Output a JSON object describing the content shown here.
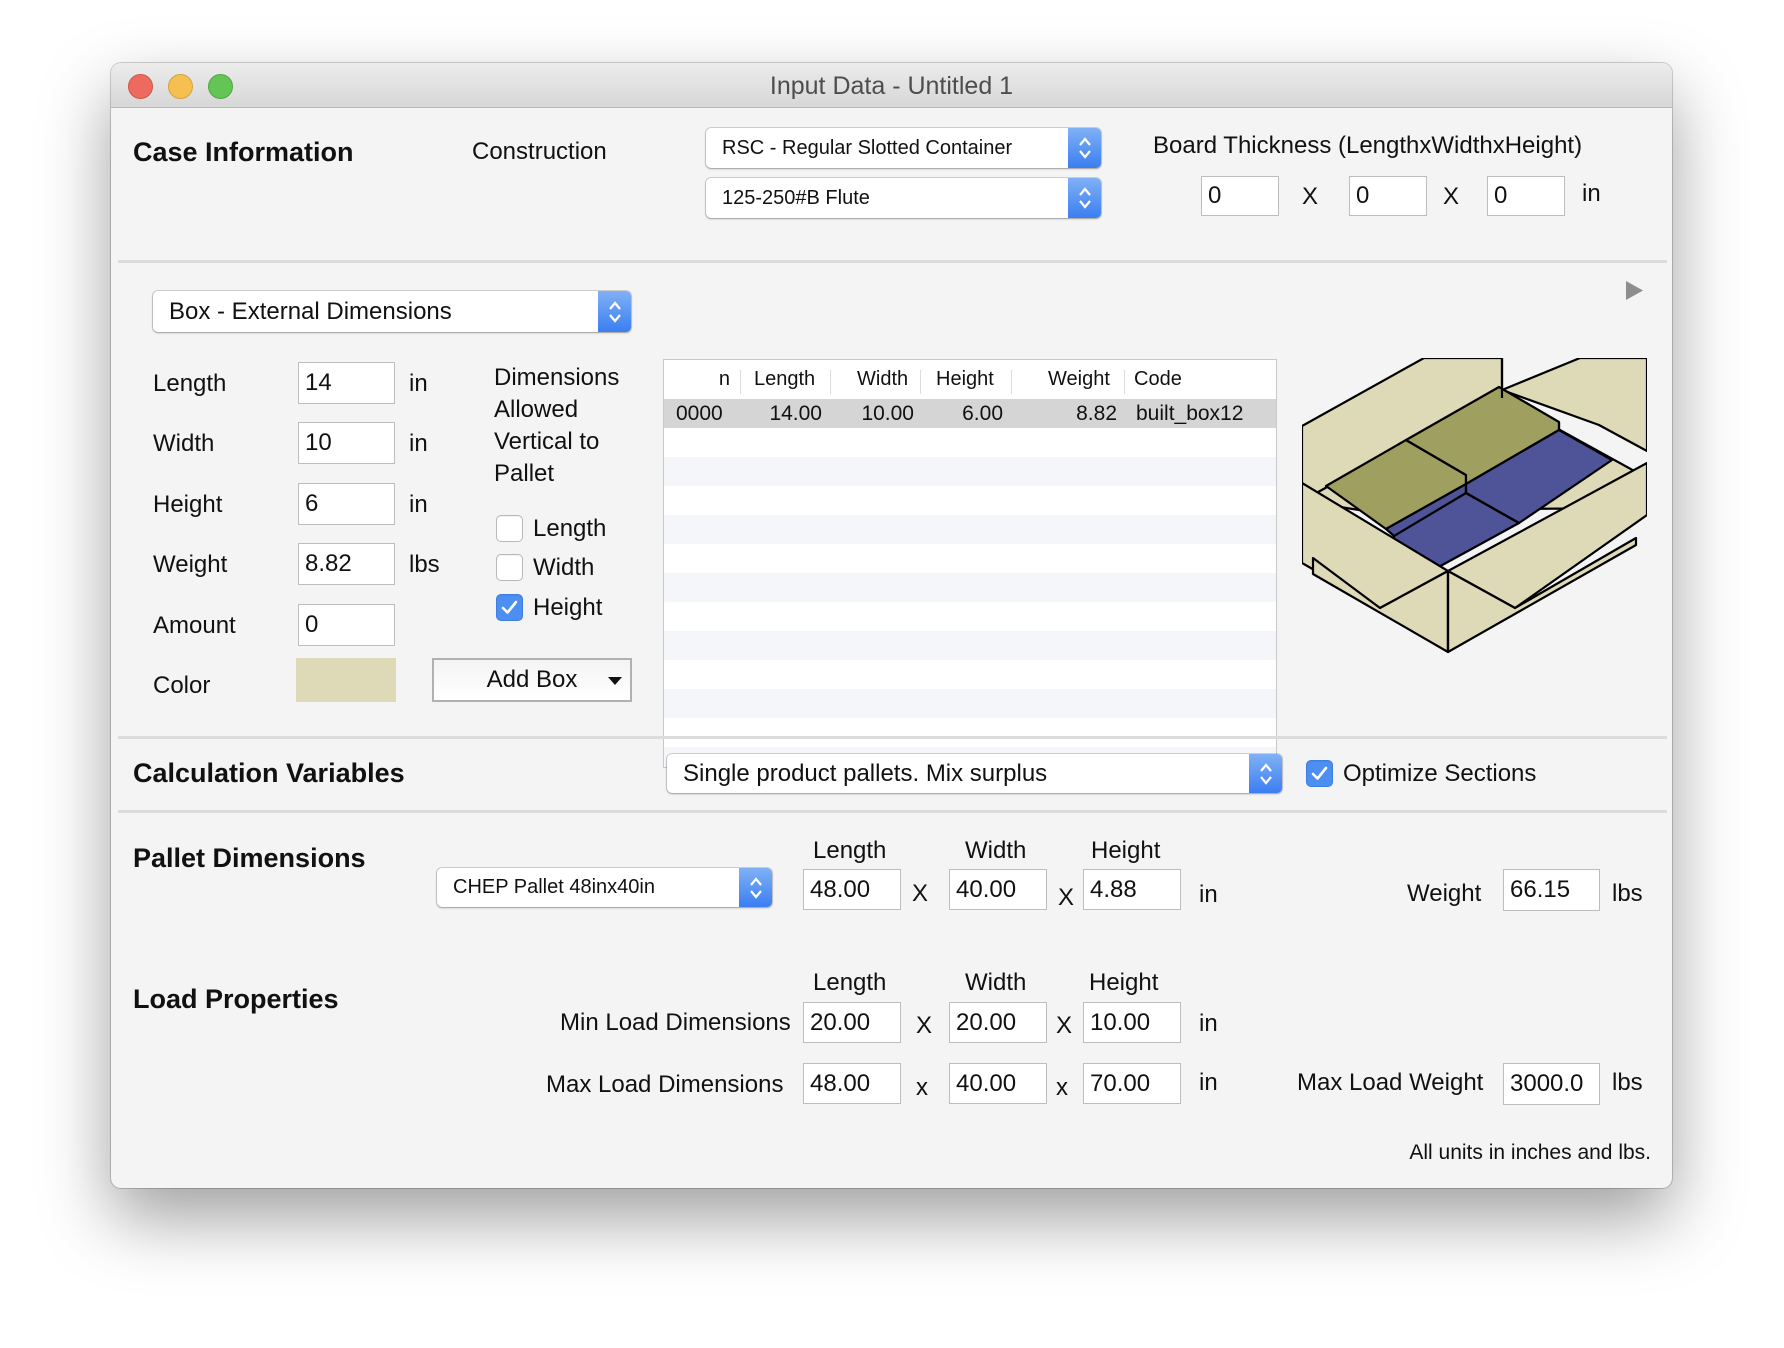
{
  "window": {
    "title": "Input Data - Untitled 1",
    "controls": [
      "close",
      "minimize",
      "zoom"
    ]
  },
  "case_information": {
    "heading": "Case Information",
    "construction_label": "Construction",
    "construction_value": "RSC - Regular Slotted Container",
    "flute_value": "125-250#B Flute",
    "board_thickness_label": "Board Thickness (LengthxWidthxHeight)",
    "board_thickness": {
      "length": "0",
      "width": "0",
      "height": "0"
    },
    "separator": "X",
    "unit": "in"
  },
  "box": {
    "mode_value": "Box - External Dimensions",
    "fields": [
      {
        "label": "Length",
        "value": "14",
        "unit": "in"
      },
      {
        "label": "Width",
        "value": "10",
        "unit": "in"
      },
      {
        "label": "Height",
        "value": "6",
        "unit": "in"
      },
      {
        "label": "Weight",
        "value": "8.82",
        "unit": "lbs"
      },
      {
        "label": "Amount",
        "value": "0",
        "unit": ""
      }
    ],
    "color_label": "Color",
    "color_value": "#dedab7",
    "vertical_label_lines": [
      "Dimensions",
      "Allowed",
      "Vertical to",
      "Pallet"
    ],
    "vertical_options": [
      {
        "label": "Length",
        "checked": false
      },
      {
        "label": "Width",
        "checked": false
      },
      {
        "label": "Height",
        "checked": true
      }
    ],
    "add_button": "Add Box",
    "add_button_icon": "dropdown-arrow-icon"
  },
  "box_table": {
    "columns": [
      "n",
      "Length",
      "Width",
      "Height",
      "Weight",
      "Code"
    ],
    "rows": [
      {
        "n": "0000",
        "length": "14.00",
        "width": "10.00",
        "height": "6.00",
        "weight": "8.82",
        "code": "built_box12",
        "selected": true
      }
    ]
  },
  "preview": {
    "disclosure_icon": "play-triangle-icon",
    "colors": {
      "box": "#dedab7",
      "product_top": "#9f9f5f",
      "product_bottom": "#4f5397",
      "edge": "#000000"
    }
  },
  "calculation": {
    "heading": "Calculation Variables",
    "mode_value": "Single product pallets. Mix surplus",
    "optimize_label": "Optimize Sections",
    "optimize_checked": true
  },
  "pallet": {
    "heading": "Pallet Dimensions",
    "type_value": "CHEP Pallet 48inx40in",
    "col_headers": [
      "Length",
      "Width",
      "Height"
    ],
    "length": "48.00",
    "width": "40.00",
    "height": "4.88",
    "separator": "X",
    "unit": "in",
    "weight_label": "Weight",
    "weight_value": "66.15",
    "weight_unit": "lbs"
  },
  "load": {
    "heading": "Load Properties",
    "col_headers": [
      "Length",
      "Width",
      "Height"
    ],
    "min_label": "Min Load Dimensions",
    "min": {
      "length": "20.00",
      "width": "20.00",
      "height": "10.00"
    },
    "max_label": "Max Load Dimensions",
    "max": {
      "length": "48.00",
      "width": "40.00",
      "height": "70.00"
    },
    "separator_min": "X",
    "separator_max": "x",
    "unit": "in",
    "max_weight_label": "Max Load Weight",
    "max_weight_value": "3000.0",
    "max_weight_unit": "lbs"
  },
  "footer_note": "All units in inches and lbs."
}
